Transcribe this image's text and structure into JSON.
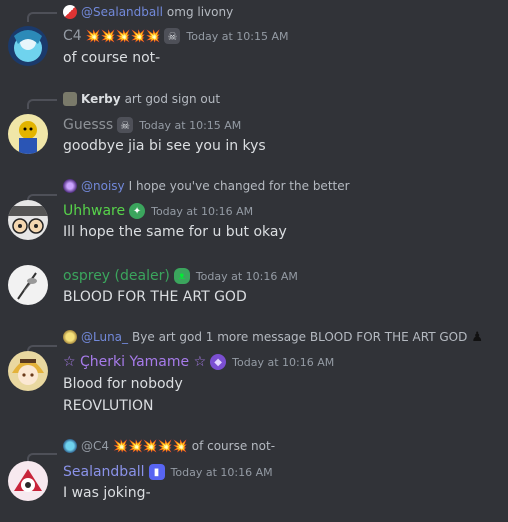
{
  "messages": [
    {
      "reply": {
        "author": "@Sealandball",
        "text": "omg livony"
      },
      "author": "C4",
      "badges": "💥💥💥💥💥",
      "timestamp": "Today at 10:15 AM",
      "lines": [
        "of course not-"
      ],
      "colors": {
        "author": "#949ba4",
        "reply_author": "#7289da"
      }
    },
    {
      "reply": {
        "author": "Kerby",
        "text": "art god sign out"
      },
      "author": "Guesss",
      "timestamp": "Today at 10:15 AM",
      "lines": [
        "goodbye jia bi see you in kys"
      ],
      "colors": {
        "author": "#8e9297",
        "reply_author": "#b5bac1"
      }
    },
    {
      "reply": {
        "author": "@noisy",
        "text": "I hope you've changed for the better"
      },
      "author": "Uhhware",
      "timestamp": "Today at 10:16 AM",
      "lines": [
        "Ill hope the same for u but okay"
      ],
      "colors": {
        "author": "#57d34a",
        "reply_author": "#7289da"
      }
    },
    {
      "author": "osprey (dealer)",
      "timestamp": "Today at 10:16 AM",
      "lines": [
        "BLOOD FOR THE ART GOD"
      ],
      "colors": {
        "author": "#3ba55d"
      }
    },
    {
      "reply": {
        "author": "@Luna_",
        "text": "Bye art god 1 more message BLOOD FOR THE ART GOD"
      },
      "author": "☆ Çherki Yamame ☆",
      "timestamp": "Today at 10:16 AM",
      "lines": [
        "Blood for nobody",
        "REOVLUTION"
      ],
      "colors": {
        "author": "#a77bea",
        "reply_author": "#7289da"
      }
    },
    {
      "reply": {
        "author": "@C4",
        "badges": "💥💥💥💥💥",
        "text": "of course not-"
      },
      "author": "Sealandball",
      "timestamp": "Today at 10:16 AM",
      "lines": [
        "I was joking-"
      ],
      "colors": {
        "author": "#8a92e8",
        "reply_author": "#949ba4"
      }
    }
  ]
}
